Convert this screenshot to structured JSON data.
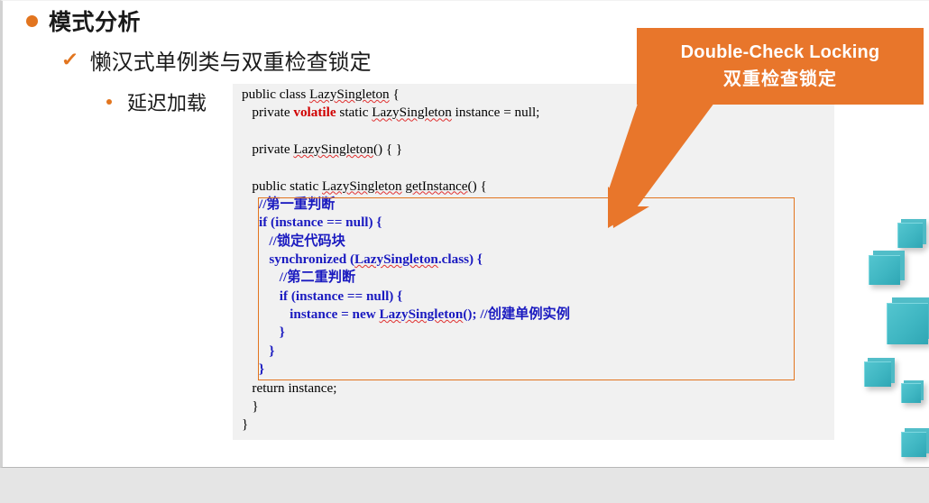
{
  "slide": {
    "bullets": {
      "level1": "模式分析",
      "level1_marker": "filled-circle",
      "level2": "懒汉式单例类与双重检查锁定",
      "level2_marker": "✓",
      "level3": "延迟加载",
      "level3_marker": "small-dot"
    },
    "code": {
      "language": "java",
      "class_name": "LazySingleton",
      "lines": [
        "public class LazySingleton {",
        "   private volatile static LazySingleton instance = null;",
        "",
        "   private LazySingleton() { }",
        "",
        "   public static LazySingleton getInstance() {",
        "      //第一重判断",
        "      if (instance == null) {",
        "         //锁定代码块",
        "         synchronized (LazySingleton.class) {",
        "            //第二重判断",
        "            if (instance == null) {",
        "               instance = new LazySingleton(); //创建单例实例",
        "            }",
        "         }",
        "      }",
        "   return instance;",
        "   }",
        "}"
      ],
      "keyword_highlight": "volatile",
      "highlighted_block_lines": [
        "//第一重判断",
        "if (instance == null) {",
        "   //锁定代码块",
        "   synchronized (LazySingleton.class) {",
        "      //第二重判断",
        "      if (instance == null) {",
        "         instance = new LazySingleton(); //创建单例实例",
        "      }",
        "   }",
        "}"
      ]
    },
    "callout": {
      "title_en": "Double-Check Locking",
      "title_zh": "双重检查锁定",
      "arrow": "down-left-arrow"
    },
    "decoration": {
      "cubes_label": "teal-cubes",
      "cube_count": 7
    },
    "colors": {
      "accent_orange": "#e8762b",
      "bullet_orange": "#e2751f",
      "code_bg": "#f1f1f1",
      "code_highlight_blue": "#1a1ac0",
      "keyword_red": "#d00000",
      "cube_teal": "#43b8c4",
      "slide_bg": "#ffffff",
      "chrome_gray": "#e5e5e5"
    }
  }
}
